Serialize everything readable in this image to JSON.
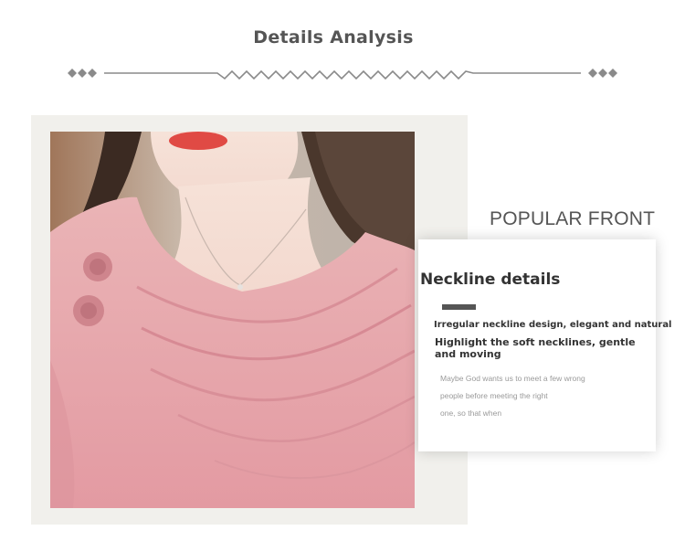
{
  "header": {
    "title": "Details Analysis"
  },
  "colors": {
    "divider": "#8a8a8a",
    "frame": "#f1f0ec",
    "garment_pink": "#e9a8ae",
    "text_dark": "#333333",
    "text_light": "#9a9a9a"
  },
  "side_label": "POPULAR FRONT",
  "card": {
    "heading": "Neckline details",
    "line1": "Irregular neckline design, elegant and natural",
    "line2": "Highlight the soft necklines, gentle and moving",
    "small_lines": [
      "Maybe God wants us to meet a few wrong",
      "people before meeting the right",
      "one, so that when"
    ]
  },
  "photo": {
    "subject": "model wearing pink draped-neck top with rosette details"
  }
}
